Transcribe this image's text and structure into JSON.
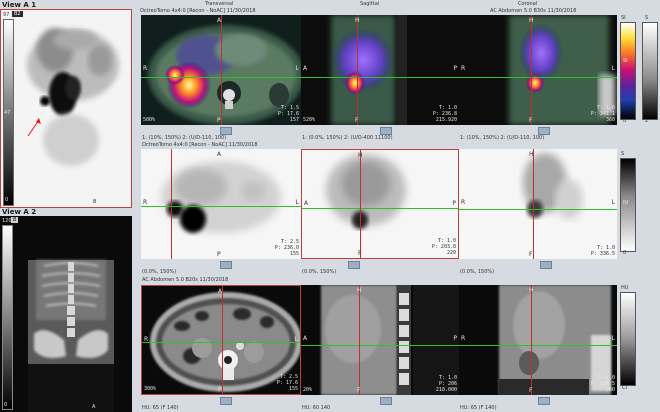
{
  "view_a1": {
    "title": "View A 1",
    "badge": "B2",
    "scale_top": "97",
    "scale_mid": "47",
    "scale_bot": "0",
    "bottom_label": "B",
    "arrow_color": "#e02020"
  },
  "view_a2": {
    "title": "View A 2",
    "badge": "B",
    "scale_top": "120",
    "scale_bot": "0",
    "bottom_label": "A"
  },
  "columns": {
    "col1": "Transversal",
    "col2": "Sagittal",
    "col3": "Coronal"
  },
  "row1": {
    "header1": "OctreoTomo 4x4:0 [Recon - NoAC] 11/30/2018",
    "header2": "AC Abdomen 5.0 B30s 11/30/2018",
    "p1": {
      "top": "A",
      "left": "R",
      "right": "L",
      "bottom": "P",
      "zoom": "500%",
      "t": "T: 1.5",
      "p": "P: 17.6",
      "v": "157"
    },
    "p2": {
      "top": "H",
      "left": "A",
      "right": "P",
      "bottom": "F",
      "zoom": "520%",
      "t": "T: 1.0",
      "p": "P: 236.8",
      "v": "215.920"
    },
    "p3": {
      "top": "H",
      "left": "R",
      "right": "L",
      "bottom": "F",
      "zoom": "",
      "t": "T: 1.0",
      "p": "P: 341.1",
      "v": "360"
    },
    "status": [
      "1: (10%, 150%)   2: (U/D-110, 100)",
      "1: (0.0%, 150%)   2: (U/D-400 11100)",
      "1: (10%, 150%)   2: (U/D-110, 100)"
    ],
    "lut_top": "SI",
    "lut_mid": "5I",
    "lut_bot": "0",
    "lut2_top": "S",
    "lut2_bot": "2"
  },
  "row2": {
    "header": "OctreoTomo 4x4:0 [Recon - NoAC] 11/30/2018",
    "p1": {
      "top": "A",
      "left": "R",
      "right": "L",
      "bottom": "P",
      "t": "T: 2.5",
      "p": "P: 236.0",
      "v": "155"
    },
    "p2": {
      "top": "H",
      "left": "A",
      "right": "P",
      "bottom": "F",
      "t": "T: 1.0",
      "p": "P: 203.8",
      "v": "220"
    },
    "p3": {
      "top": "H",
      "left": "R",
      "right": "L",
      "bottom": "F",
      "t": "T: 1.0",
      "p": "P: 336.5",
      "v": ""
    },
    "status": [
      "(0.0%, 150%)",
      "(0.0%, 150%)",
      "(0.0%, 150%)"
    ],
    "lut_top": "S",
    "lut_mid": "NI",
    "lut_bot": "0"
  },
  "row3": {
    "header": "AC Abdomen 5.0 B20s 11/30/2018",
    "p1": {
      "top": "A",
      "left": "R",
      "right": "L",
      "bottom": "P",
      "zoom": "300%",
      "t": "T: 2.5",
      "p": "P: 17.6",
      "v": "155"
    },
    "p2": {
      "top": "H",
      "left": "A",
      "right": "P",
      "bottom": "F",
      "zoom": "20%",
      "t": "T: 1.0",
      "p": "P: 206",
      "v": "218.000"
    },
    "p3": {
      "top": "H",
      "left": "R",
      "right": "L",
      "bottom": "F",
      "zoom": "",
      "t": "T: 1.0",
      "p": "P: 336.5",
      "v": "360"
    },
    "status": [
      "HU: 65 (F 140)",
      "HU: 60  140",
      "HU: 65 (F 140)"
    ],
    "lut_top": "HU",
    "lut_bot": "CI"
  }
}
